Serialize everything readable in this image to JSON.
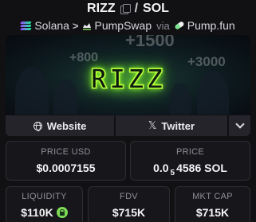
{
  "header": {
    "symbol": "RIZZ",
    "separator": "/",
    "quote": "SOL"
  },
  "chain_row": {
    "chain": "Solana",
    "dex": "PumpSwap",
    "via": "via",
    "launchpad": "Pump.fun"
  },
  "banner": {
    "token_art_text": "RIZZ",
    "background_numbers": [
      "+800",
      "+1500",
      "+3000"
    ]
  },
  "links": {
    "website_label": "Website",
    "twitter_label": "Twitter"
  },
  "stats": {
    "price_usd": {
      "label": "PRICE USD",
      "value": "$0.0007155"
    },
    "price_sol": {
      "label": "PRICE",
      "value_prefix": "0.0",
      "value_subscript": "5",
      "value_rest": "4586 SOL"
    },
    "liquidity": {
      "label": "LIQUIDITY",
      "value": "$110K"
    },
    "fdv": {
      "label": "FDV",
      "value": "$715K"
    },
    "mkt_cap": {
      "label": "MKT CAP",
      "value": "$715K"
    }
  },
  "colors": {
    "accent_green": "#7ed957",
    "background": "#111114",
    "card_bg": "#17171b"
  }
}
